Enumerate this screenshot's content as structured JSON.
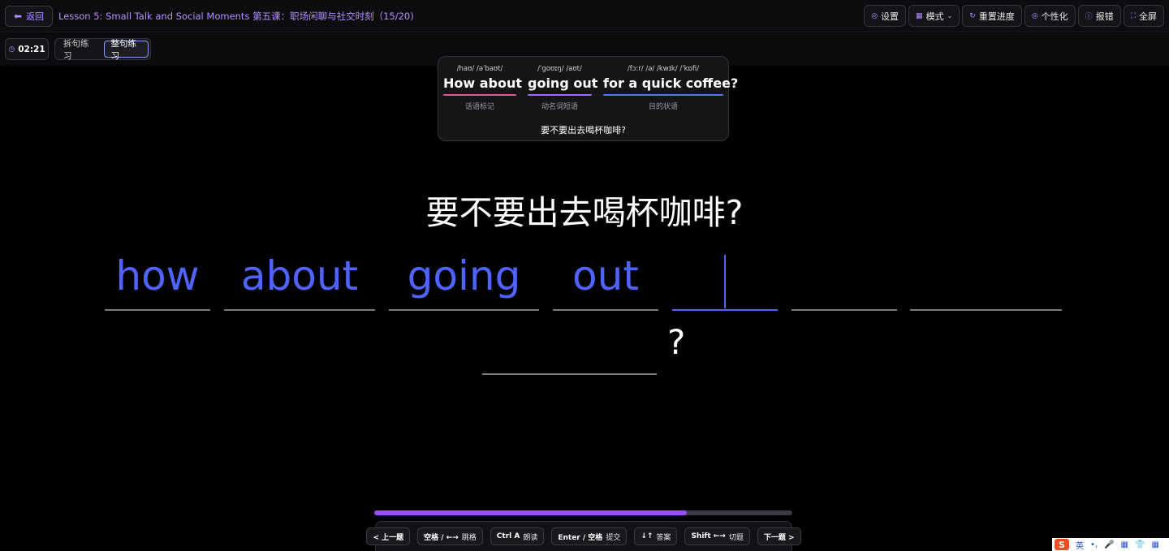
{
  "topbar": {
    "back_label": "返回",
    "lesson_title": "Lesson 5: Small Talk and Social Moments 第五课：职场闲聊与社交时刻（15/20)",
    "actions": [
      {
        "label": "设置",
        "icon": "gear-icon"
      },
      {
        "label": "模式",
        "icon": "grid-icon"
      },
      {
        "label": "重置进度",
        "icon": "reset-icon"
      },
      {
        "label": "个性化",
        "icon": "palette-icon"
      },
      {
        "label": "报错",
        "icon": "alert-icon"
      },
      {
        "label": "全屏",
        "icon": "fullscreen-icon"
      }
    ]
  },
  "subbar": {
    "timer": "02:21",
    "modes": [
      "拆句练习",
      "整句练习"
    ],
    "active_mode": "整句练习"
  },
  "analysis": {
    "chunks": [
      {
        "ipa": "/haʊ/ /əˈbaʊt/",
        "text": "How about",
        "role": "话语标记",
        "color": "#e8579a"
      },
      {
        "ipa": "/ˈɡoʊɪŋ/ /aʊt/",
        "text": "going out",
        "role": "动名词短语",
        "color": "#a46bff"
      },
      {
        "ipa": "/fɔːr/ /ə/ /kwɪk/ /ˈkɒfi/",
        "text": "for a quick coffee?",
        "role": "目的状语",
        "color": "#4f7bff"
      }
    ],
    "translation": "要不要出去喝杯咖啡?"
  },
  "prompt": {
    "chinese": "要不要出去喝杯咖啡?",
    "words": [
      "how",
      "about",
      "going",
      "out",
      "",
      "",
      "",
      ""
    ],
    "punctuation": "?"
  },
  "progress": {
    "fraction": 0.748,
    "color": "#9b4dff"
  },
  "shortcuts": [
    {
      "key": "",
      "label": "< 上一题"
    },
    {
      "key": "空格 / ←→",
      "label": "跳格"
    },
    {
      "key": "Ctrl A",
      "label": "朗读"
    },
    {
      "key": "Enter / 空格",
      "label": "提交"
    },
    {
      "key": "↓↑",
      "label": "答案"
    },
    {
      "key": "Shift ←→",
      "label": "切题"
    },
    {
      "key": "",
      "label": "下一题 >"
    }
  ],
  "ime": {
    "logo": "S",
    "mode": "英"
  }
}
